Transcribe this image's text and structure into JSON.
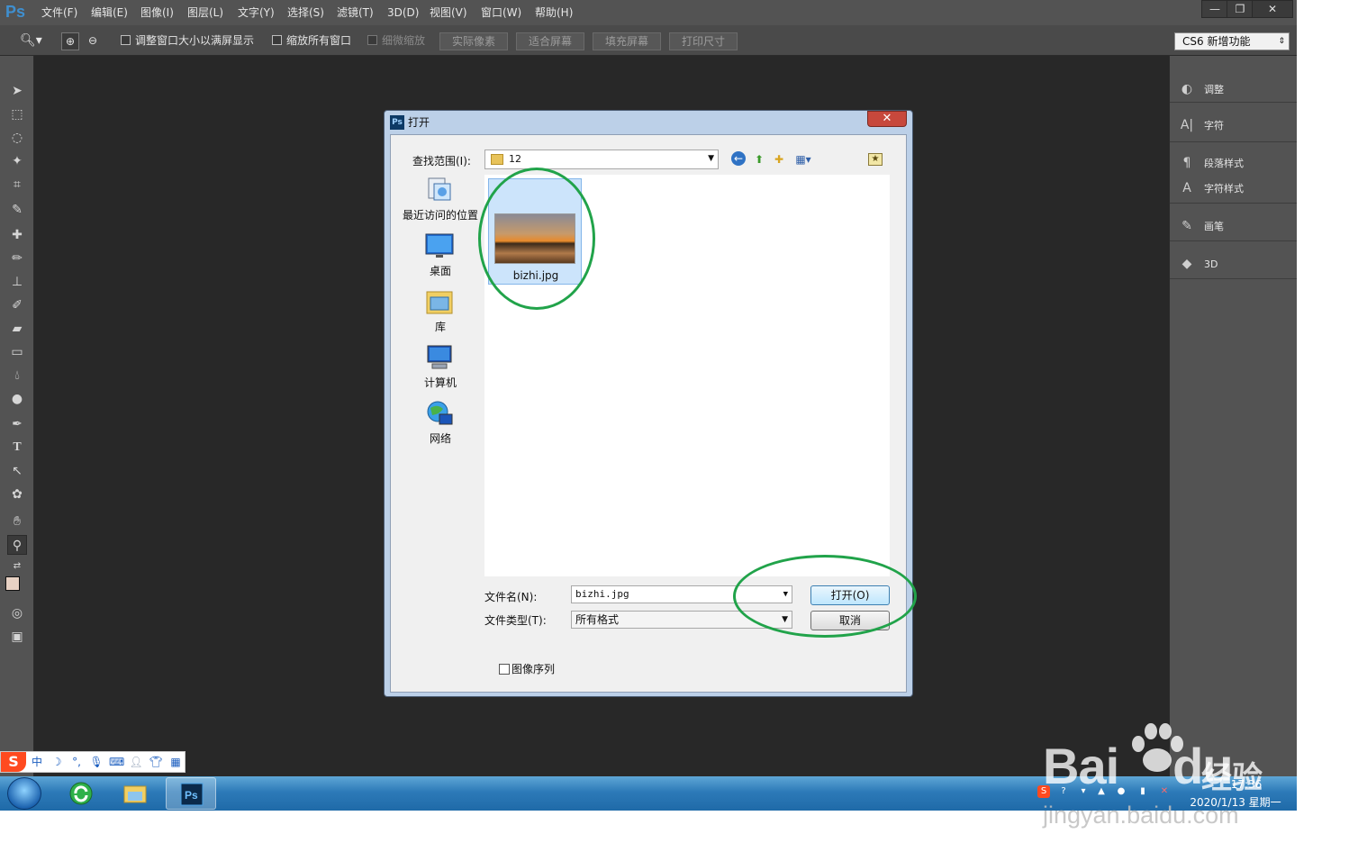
{
  "app": {
    "logo": "Ps"
  },
  "menu": [
    "文件(F)",
    "编辑(E)",
    "图像(I)",
    "图层(L)",
    "文字(Y)",
    "选择(S)",
    "滤镜(T)",
    "3D(D)",
    "视图(V)",
    "窗口(W)",
    "帮助(H)"
  ],
  "window_controls": {
    "minimize": "—",
    "restore": "❐",
    "close": "✕"
  },
  "options": {
    "resize_windows": "调整窗口大小以满屏显示",
    "zoom_all_windows": "缩放所有窗口",
    "scrubby_zoom": "细微缩放",
    "actual_pixels": "实际像素",
    "fit_screen": "适合屏幕",
    "fill_screen": "填充屏幕",
    "print_size": "打印尺寸",
    "workspace": "CS6 新增功能"
  },
  "panels": {
    "adjustments": "调整",
    "character": "字符",
    "paragraph_styles": "段落样式",
    "character_styles": "字符样式",
    "brush": "画笔",
    "three_d": "3D"
  },
  "dialog": {
    "title": "打开",
    "look_in_label": "查找范围(I):",
    "look_in_value": "12",
    "places": [
      "最近访问的位置",
      "桌面",
      "库",
      "计算机",
      "网络"
    ],
    "file": {
      "name": "bizhi.jpg"
    },
    "filename_label": "文件名(N):",
    "filename_value": "bizhi.jpg",
    "filetype_label": "文件类型(T):",
    "filetype_value": "所有格式",
    "open_button": "打开(O)",
    "cancel_button": "取消",
    "image_sequence": "图像序列"
  },
  "taskbar": {
    "time": "17:36",
    "date": "2020/1/13 星期一"
  },
  "watermark": {
    "brand": "Bai",
    "brand2": "du",
    "product": "经验",
    "url": "jingyan.baidu.com"
  },
  "colors": {
    "ps_bg": "#282828",
    "ps_panel": "#535353",
    "annotation": "#21a34a"
  }
}
